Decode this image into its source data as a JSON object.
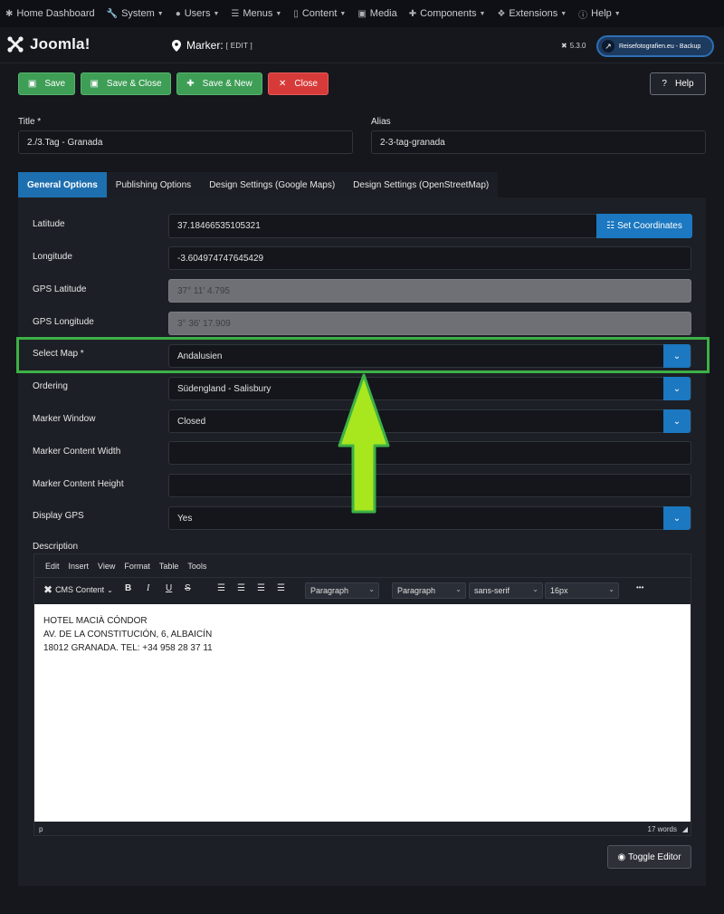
{
  "topnav": {
    "items": [
      {
        "label": "Home Dashboard",
        "icon": "joomla-icon"
      },
      {
        "label": "System",
        "icon": "wrench-icon",
        "caret": true
      },
      {
        "label": "Users",
        "icon": "users-icon",
        "caret": true
      },
      {
        "label": "Menus",
        "icon": "list-icon",
        "caret": true
      },
      {
        "label": "Content",
        "icon": "file-icon",
        "caret": true
      },
      {
        "label": "Media",
        "icon": "image-icon",
        "caret": false
      },
      {
        "label": "Components",
        "icon": "puzzle-icon",
        "caret": true
      },
      {
        "label": "Extensions",
        "icon": "cubes-icon",
        "caret": true
      },
      {
        "label": "Help",
        "icon": "info-icon",
        "caret": true
      }
    ]
  },
  "header": {
    "brand": "Joomla!",
    "title": "Marker:",
    "title_sub": "[ EDIT ]",
    "version": "5.3.0",
    "site_button": "Reisefotografien.eu - Backup"
  },
  "toolbar": {
    "save": "Save",
    "save_close": "Save & Close",
    "save_new": "Save & New",
    "close": "Close",
    "help": "Help"
  },
  "fields_top": {
    "title_label": "Title *",
    "title_value": "2./3.Tag - Granada",
    "alias_label": "Alias",
    "alias_value": "2-3-tag-granada"
  },
  "tabs": [
    "General Options",
    "Publishing Options",
    "Design Settings (Google Maps)",
    "Design Settings (OpenStreetMap)"
  ],
  "form": {
    "latitude_label": "Latitude",
    "latitude_value": "37.18466535105321",
    "set_coordinates": "Set Coordinates",
    "longitude_label": "Longitude",
    "longitude_value": "-3.604974747645429",
    "gps_lat_label": "GPS Latitude",
    "gps_lat_value": "37° 11' 4.795",
    "gps_lon_label": "GPS Longitude",
    "gps_lon_value": "3° 36' 17.909",
    "select_map_label": "Select Map *",
    "select_map_value": "Andalusien",
    "ordering_label": "Ordering",
    "ordering_value": "Südengland - Salisbury",
    "marker_window_label": "Marker Window",
    "marker_window_value": "Closed",
    "content_width_label": "Marker Content Width",
    "content_width_value": "",
    "content_height_label": "Marker Content Height",
    "content_height_value": "",
    "display_gps_label": "Display GPS",
    "display_gps_value": "Yes",
    "description_label": "Description"
  },
  "editor": {
    "menu": [
      "Edit",
      "Insert",
      "View",
      "Format",
      "Table",
      "Tools"
    ],
    "cms_content": "CMS Content",
    "bold": "B",
    "italic": "I",
    "underline": "U",
    "strike": "S",
    "dd1": "Paragraph",
    "dd2": "Paragraph",
    "dd3": "sans-serif",
    "dd4": "16px",
    "more": "•••",
    "content_lines": [
      "HOTEL MACIÀ CÓNDOR",
      "AV. DE LA CONSTITUCIÓN, 6, ALBAICÍN",
      "18012 GRANADA. TEL: +34 958 28 37 11"
    ],
    "status_path": "p",
    "word_count": "17 words"
  },
  "toggle_editor": "Toggle Editor",
  "colors": {
    "accent": "#1c78c0",
    "green": "#3e9e56",
    "red": "#d73b39",
    "highlight": "#3db146",
    "arrow_fill": "#a8e61e"
  }
}
